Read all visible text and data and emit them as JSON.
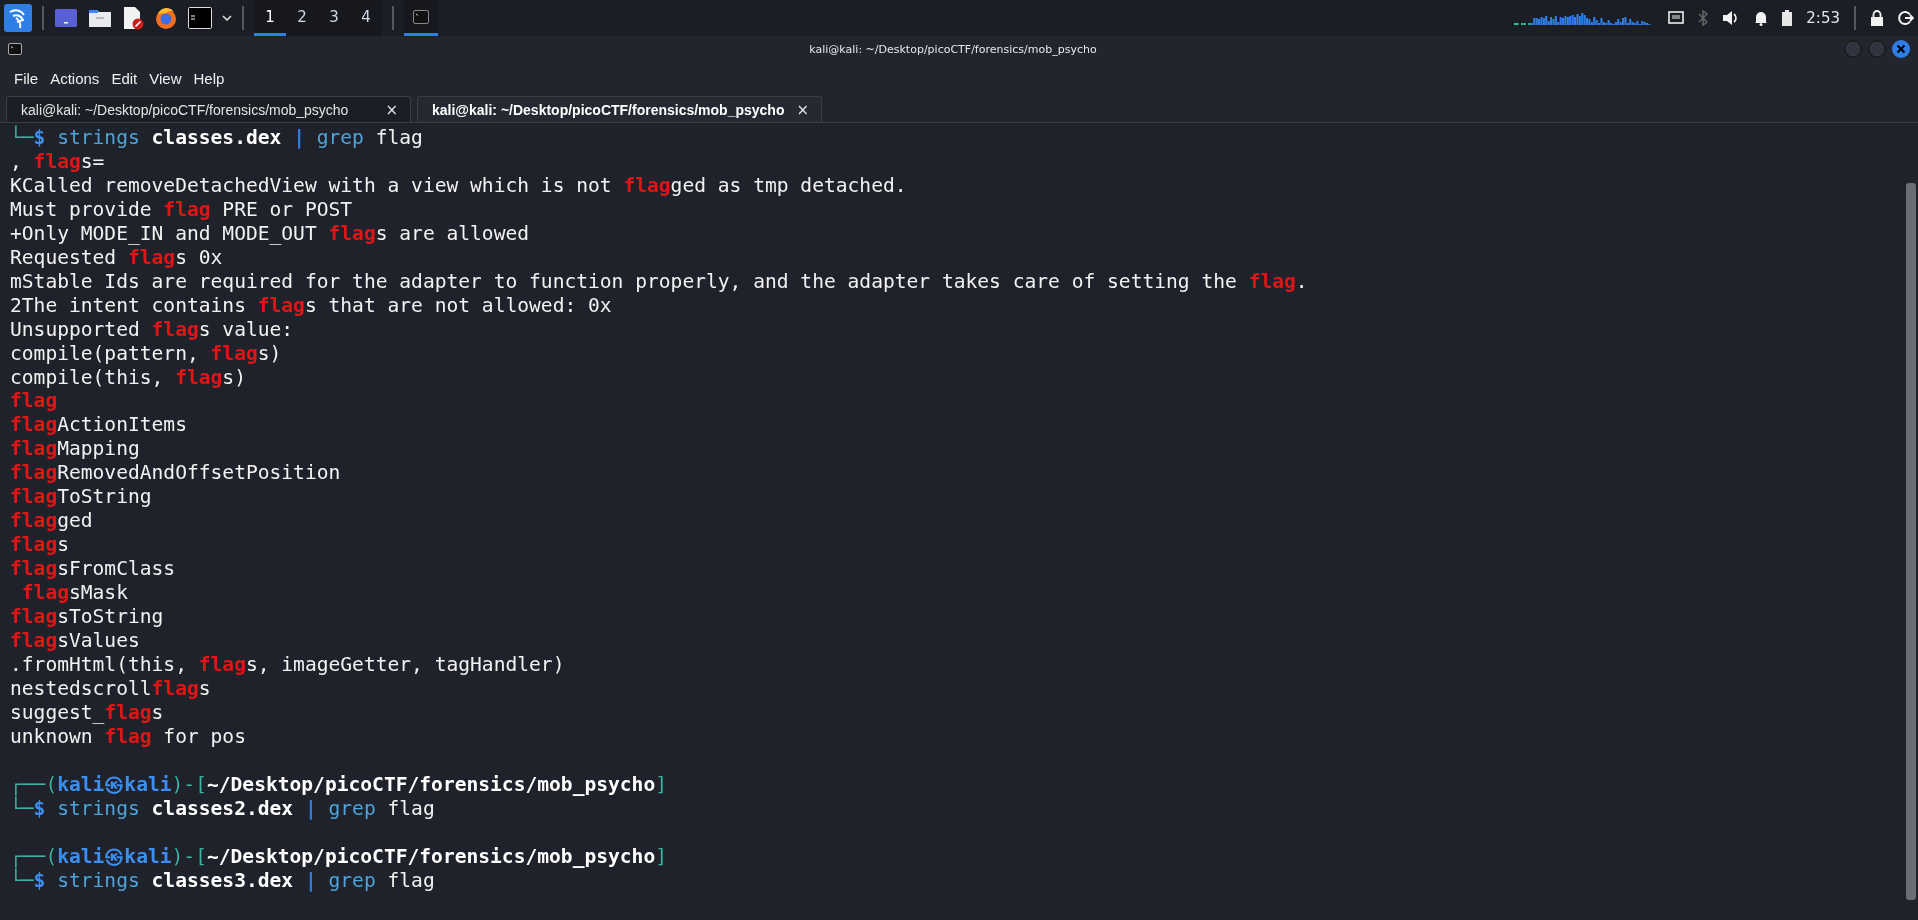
{
  "taskbar": {
    "workspaces": [
      {
        "label": "1",
        "selected": true
      },
      {
        "label": "2",
        "selected": false
      },
      {
        "label": "3",
        "selected": false
      },
      {
        "label": "4",
        "selected": false
      }
    ],
    "clock": "2:53"
  },
  "window": {
    "title": "kali@kali: ~/Desktop/picoCTF/forensics/mob_psycho"
  },
  "menu": [
    "File",
    "Actions",
    "Edit",
    "View",
    "Help"
  ],
  "tabs": [
    {
      "label": "kali@kali: ~/Desktop/picoCTF/forensics/mob_psycho",
      "close": "×",
      "selected": false
    },
    {
      "label": "kali@kali: ~/Desktop/picoCTF/forensics/mob_psycho",
      "close": "×",
      "selected": true
    }
  ],
  "terminal": {
    "lines": [
      {
        "kind": "text",
        "segments": [
          {
            "kind": "frame",
            "text": "└─"
          },
          {
            "kind": "dollar",
            "text": "$ "
          },
          {
            "kind": "cmd",
            "text": "strings "
          },
          {
            "kind": "file",
            "text": "classes.dex "
          },
          {
            "kind": "pipe",
            "text": "| "
          },
          {
            "kind": "cmd",
            "text": "grep"
          },
          {
            "kind": "plain",
            "text": " flag"
          }
        ]
      },
      {
        "kind": "text",
        "segments": [
          {
            "kind": "plain",
            "text": ", "
          },
          {
            "kind": "match",
            "text": "flag"
          },
          {
            "kind": "plain",
            "text": "s="
          }
        ]
      },
      {
        "kind": "text",
        "segments": [
          {
            "kind": "plain",
            "text": "KCalled removeDetachedView with a view which is not "
          },
          {
            "kind": "match",
            "text": "flag"
          },
          {
            "kind": "plain",
            "text": "ged as tmp detached."
          }
        ]
      },
      {
        "kind": "text",
        "segments": [
          {
            "kind": "plain",
            "text": "Must provide "
          },
          {
            "kind": "match",
            "text": "flag"
          },
          {
            "kind": "plain",
            "text": " PRE or POST"
          }
        ]
      },
      {
        "kind": "text",
        "segments": [
          {
            "kind": "plain",
            "text": "+Only MODE_IN and MODE_OUT "
          },
          {
            "kind": "match",
            "text": "flag"
          },
          {
            "kind": "plain",
            "text": "s are allowed"
          }
        ]
      },
      {
        "kind": "text",
        "segments": [
          {
            "kind": "plain",
            "text": "Requested "
          },
          {
            "kind": "match",
            "text": "flag"
          },
          {
            "kind": "plain",
            "text": "s 0x"
          }
        ]
      },
      {
        "kind": "text",
        "segments": [
          {
            "kind": "plain",
            "text": "mStable Ids are required for the adapter to function properly, and the adapter takes care of setting the "
          },
          {
            "kind": "match",
            "text": "flag"
          },
          {
            "kind": "plain",
            "text": "."
          }
        ]
      },
      {
        "kind": "text",
        "segments": [
          {
            "kind": "plain",
            "text": "2The intent contains "
          },
          {
            "kind": "match",
            "text": "flag"
          },
          {
            "kind": "plain",
            "text": "s that are not allowed: 0x"
          }
        ]
      },
      {
        "kind": "text",
        "segments": [
          {
            "kind": "plain",
            "text": "Unsupported "
          },
          {
            "kind": "match",
            "text": "flag"
          },
          {
            "kind": "plain",
            "text": "s value:"
          }
        ]
      },
      {
        "kind": "text",
        "segments": [
          {
            "kind": "plain",
            "text": "compile(pattern, "
          },
          {
            "kind": "match",
            "text": "flag"
          },
          {
            "kind": "plain",
            "text": "s)"
          }
        ]
      },
      {
        "kind": "text",
        "segments": [
          {
            "kind": "plain",
            "text": "compile(this, "
          },
          {
            "kind": "match",
            "text": "flag"
          },
          {
            "kind": "plain",
            "text": "s)"
          }
        ]
      },
      {
        "kind": "text",
        "segments": [
          {
            "kind": "match",
            "text": "flag"
          }
        ]
      },
      {
        "kind": "text",
        "segments": [
          {
            "kind": "match",
            "text": "flag"
          },
          {
            "kind": "plain",
            "text": "ActionItems"
          }
        ]
      },
      {
        "kind": "text",
        "segments": [
          {
            "kind": "match",
            "text": "flag"
          },
          {
            "kind": "plain",
            "text": "Mapping"
          }
        ]
      },
      {
        "kind": "text",
        "segments": [
          {
            "kind": "match",
            "text": "flag"
          },
          {
            "kind": "plain",
            "text": "RemovedAndOffsetPosition"
          }
        ]
      },
      {
        "kind": "text",
        "segments": [
          {
            "kind": "match",
            "text": "flag"
          },
          {
            "kind": "plain",
            "text": "ToString"
          }
        ]
      },
      {
        "kind": "text",
        "segments": [
          {
            "kind": "match",
            "text": "flag"
          },
          {
            "kind": "plain",
            "text": "ged"
          }
        ]
      },
      {
        "kind": "text",
        "segments": [
          {
            "kind": "match",
            "text": "flag"
          },
          {
            "kind": "plain",
            "text": "s"
          }
        ]
      },
      {
        "kind": "text",
        "segments": [
          {
            "kind": "match",
            "text": "flag"
          },
          {
            "kind": "plain",
            "text": "sFromClass"
          }
        ]
      },
      {
        "kind": "text",
        "segments": [
          {
            "kind": "match",
            "text": " flag"
          },
          {
            "kind": "plain",
            "text": "sMask"
          }
        ]
      },
      {
        "kind": "text",
        "segments": [
          {
            "kind": "match",
            "text": "flag"
          },
          {
            "kind": "plain",
            "text": "sToString"
          }
        ]
      },
      {
        "kind": "text",
        "segments": [
          {
            "kind": "match",
            "text": "flag"
          },
          {
            "kind": "plain",
            "text": "sValues"
          }
        ]
      },
      {
        "kind": "text",
        "segments": [
          {
            "kind": "plain",
            "text": ".fromHtml(this, "
          },
          {
            "kind": "match",
            "text": "flag"
          },
          {
            "kind": "plain",
            "text": "s, imageGetter, tagHandler)"
          }
        ]
      },
      {
        "kind": "text",
        "segments": [
          {
            "kind": "plain",
            "text": "nestedscroll"
          },
          {
            "kind": "match",
            "text": "flag"
          },
          {
            "kind": "plain",
            "text": "s"
          }
        ]
      },
      {
        "kind": "text",
        "segments": [
          {
            "kind": "plain",
            "text": "suggest_"
          },
          {
            "kind": "match",
            "text": "flag"
          },
          {
            "kind": "plain",
            "text": "s"
          }
        ]
      },
      {
        "kind": "text",
        "segments": [
          {
            "kind": "plain",
            "text": "unknown "
          },
          {
            "kind": "match",
            "text": "flag"
          },
          {
            "kind": "plain",
            "text": " for pos"
          }
        ]
      },
      {
        "kind": "blank"
      },
      {
        "kind": "text",
        "segments": [
          {
            "kind": "frame",
            "text": "┌──("
          },
          {
            "kind": "user",
            "text": "kali㉿kali"
          },
          {
            "kind": "frame",
            "text": ")-["
          },
          {
            "kind": "path",
            "text": "~/Desktop/picoCTF/forensics/mob_psycho"
          },
          {
            "kind": "frame",
            "text": "]"
          }
        ]
      },
      {
        "kind": "text",
        "segments": [
          {
            "kind": "frame",
            "text": "└─"
          },
          {
            "kind": "dollar",
            "text": "$ "
          },
          {
            "kind": "cmd",
            "text": "strings "
          },
          {
            "kind": "file",
            "text": "classes2.dex "
          },
          {
            "kind": "pipe",
            "text": "| "
          },
          {
            "kind": "cmd",
            "text": "grep"
          },
          {
            "kind": "plain",
            "text": " flag"
          }
        ]
      },
      {
        "kind": "blank"
      },
      {
        "kind": "text",
        "segments": [
          {
            "kind": "frame",
            "text": "┌──("
          },
          {
            "kind": "user",
            "text": "kali㉿kali"
          },
          {
            "kind": "frame",
            "text": ")-["
          },
          {
            "kind": "path",
            "text": "~/Desktop/picoCTF/forensics/mob_psycho"
          },
          {
            "kind": "frame",
            "text": "]"
          }
        ]
      },
      {
        "kind": "text",
        "segments": [
          {
            "kind": "frame",
            "text": "└─"
          },
          {
            "kind": "dollar",
            "text": "$ "
          },
          {
            "kind": "cmd",
            "text": "strings "
          },
          {
            "kind": "file",
            "text": "classes3.dex "
          },
          {
            "kind": "pipe",
            "text": "| "
          },
          {
            "kind": "cmd",
            "text": "grep"
          },
          {
            "kind": "plain",
            "text": " flag"
          }
        ]
      }
    ]
  }
}
